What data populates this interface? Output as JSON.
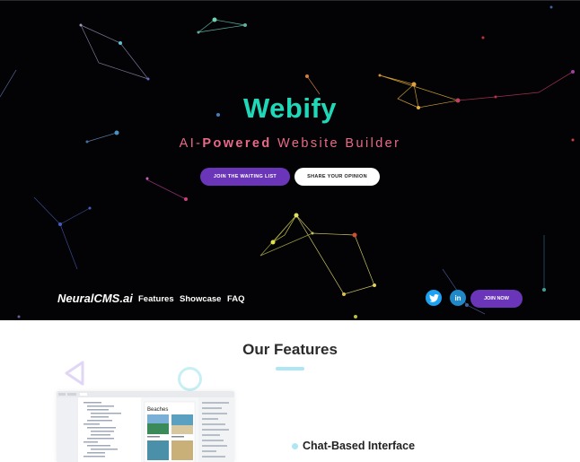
{
  "hero": {
    "title": "Webify",
    "subtitle_a": "AI-",
    "subtitle_b": "Powered",
    "subtitle_c": " W",
    "subtitle_d": "ebsite Builder",
    "cta_waiting": "JOIN THE WAITING LIST",
    "cta_opinion": "SHARE YOUR OPINION"
  },
  "nav": {
    "logo": "NeuralCMS.ai",
    "links": [
      "Features",
      "Showcase",
      "FAQ"
    ],
    "twitter_icon": "twitter-icon",
    "linkedin_icon": "linkedin-icon",
    "linkedin_text": "in",
    "join": "JOIN NOW"
  },
  "features": {
    "heading": "Our Features",
    "items": [
      "Chat-Based Interface"
    ],
    "preview_label": "Beaches"
  },
  "colors": {
    "accent_teal": "#1fd8b8",
    "accent_purple": "#6a35b8",
    "subtitle_pink": "#e86a8a",
    "hero_bg": "#030305",
    "light_cyan": "#aee6f5"
  }
}
